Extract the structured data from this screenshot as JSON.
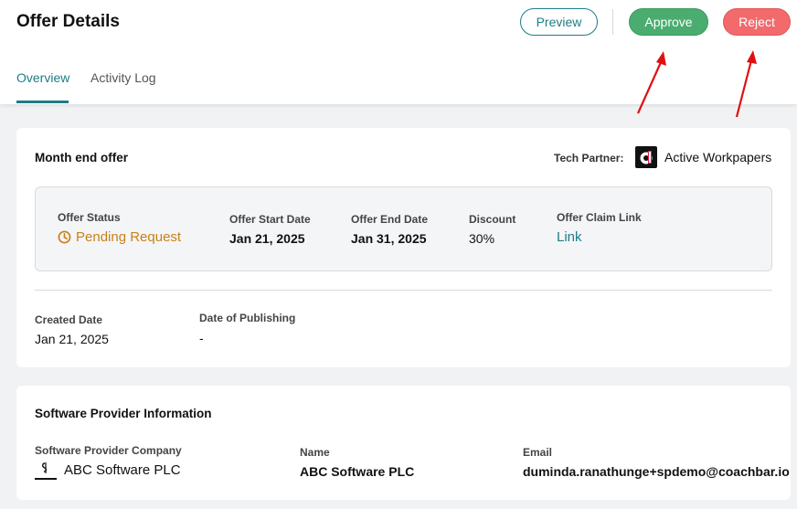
{
  "header": {
    "title": "Offer Details",
    "preview_label": "Preview",
    "approve_label": "Approve",
    "reject_label": "Reject"
  },
  "tabs": [
    {
      "label": "Overview",
      "active": true
    },
    {
      "label": "Activity Log",
      "active": false
    }
  ],
  "offer": {
    "name": "Month end offer",
    "tech_partner_label": "Tech Partner:",
    "tech_partner_name": "Active Workpapers",
    "status_label": "Offer Status",
    "status_value": "Pending Request",
    "start_label": "Offer Start Date",
    "start_value": "Jan 21, 2025",
    "end_label": "Offer End Date",
    "end_value": "Jan 31, 2025",
    "discount_label": "Discount",
    "discount_value": "30%",
    "claim_label": "Offer Claim Link",
    "claim_value": "Link",
    "created_label": "Created Date",
    "created_value": "Jan 21, 2025",
    "published_label": "Date of Publishing",
    "published_value": "-"
  },
  "provider": {
    "section_title": "Software Provider Information",
    "company_label": "Software Provider Company",
    "company_value": "ABC Software PLC",
    "name_label": "Name",
    "name_value": "ABC Software PLC",
    "email_label": "Email",
    "email_value": "duminda.ranathunge+spdemo@coachbar.io"
  },
  "colors": {
    "accent": "#1c7d86",
    "approve": "#4aad6f",
    "reject": "#f26a6c",
    "pending": "#c8801a",
    "annotation_arrow": "#e01010"
  },
  "icons": [
    "clock-icon",
    "active-workpapers-logo",
    "abc-software-logo",
    "annotation-arrow"
  ]
}
